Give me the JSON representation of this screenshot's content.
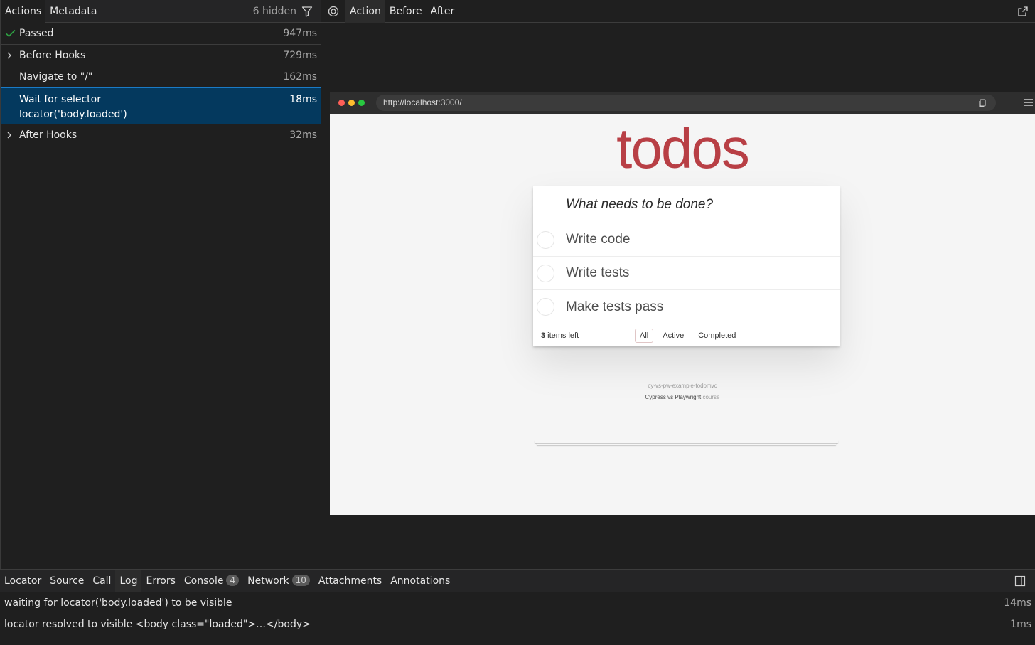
{
  "left": {
    "tabs": [
      "Actions",
      "Metadata"
    ],
    "hidden_count": "6 hidden",
    "rows": [
      {
        "title": "Passed",
        "duration": "947ms"
      },
      {
        "title": "Before Hooks",
        "duration": "729ms"
      },
      {
        "title": "Navigate to \"/\"",
        "duration": "162ms"
      },
      {
        "title": "Wait for selector",
        "subtitle": "locator('body.loaded')",
        "duration": "18ms"
      },
      {
        "title": "After Hooks",
        "duration": "32ms"
      }
    ]
  },
  "right": {
    "tabs": [
      "Action",
      "Before",
      "After"
    ],
    "browser": {
      "url": "http://localhost:3000/",
      "app": {
        "title": "todos",
        "placeholder": "What needs to be done?",
        "items": [
          "Write code",
          "Write tests",
          "Make tests pass"
        ],
        "count": "3",
        "count_suffix": "items left",
        "filters": [
          "All",
          "Active",
          "Completed"
        ],
        "info_line": "cy-vs-pw-example-todomvc",
        "credit_main": "Cypress vs Playwright",
        "credit_suffix": "course"
      }
    }
  },
  "bottom": {
    "tabs": [
      "Locator",
      "Source",
      "Call",
      "Log",
      "Errors",
      "Console",
      "Network",
      "Attachments",
      "Annotations"
    ],
    "console_badge": "4",
    "network_badge": "10",
    "log": [
      {
        "text": "waiting for locator('body.loaded') to be visible",
        "duration": "14ms"
      },
      {
        "text": "locator resolved to visible <body class=\"loaded\">…</body>",
        "duration": "1ms"
      }
    ]
  },
  "colors": {
    "selection": "#04395e",
    "selection_border": "#1a7bc7",
    "passed_check": "#2ea043",
    "todos_red": "#b83f45"
  },
  "icons": [
    "check-icon",
    "chevron-right-icon",
    "filter-icon",
    "target-icon",
    "external-link-icon",
    "copy-icon",
    "hamburger-menu-icon",
    "dock-layout-icon"
  ]
}
